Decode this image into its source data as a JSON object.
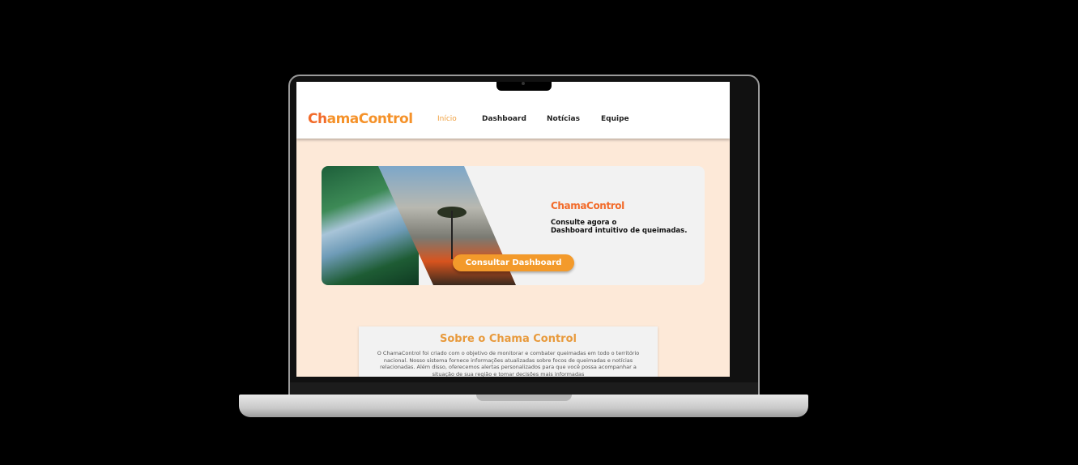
{
  "site": {
    "logo_a": "Ch",
    "logo_b": "ama",
    "logo_c": "Control"
  },
  "nav": {
    "items": [
      {
        "label": "Início",
        "active": true
      },
      {
        "label": "Dashboard"
      },
      {
        "label": "Notícias"
      },
      {
        "label": "Equipe"
      }
    ]
  },
  "banner": {
    "logo": "ChamaControl",
    "line1": "Consulte agora o",
    "line2": "Dashboard intuitivo de queimadas.",
    "button": "Consultar Dashboard"
  },
  "about": {
    "title": "Sobre o Chama Control",
    "text": "O ChamaControl foi criado com o objetivo de monitorar e combater queimadas em todo o território nacional. Nosso sistema fornece informações atualizadas sobre focos de queimadas e notícias relacionadas. Além disso, oferecemos alertas personalizados para que você possa acompanhar a situação de sua região e tomar decisões mais informadas"
  },
  "colors": {
    "accent": "#f39a2b",
    "logo": "#f26b2a",
    "bg": "#fde9d8"
  }
}
